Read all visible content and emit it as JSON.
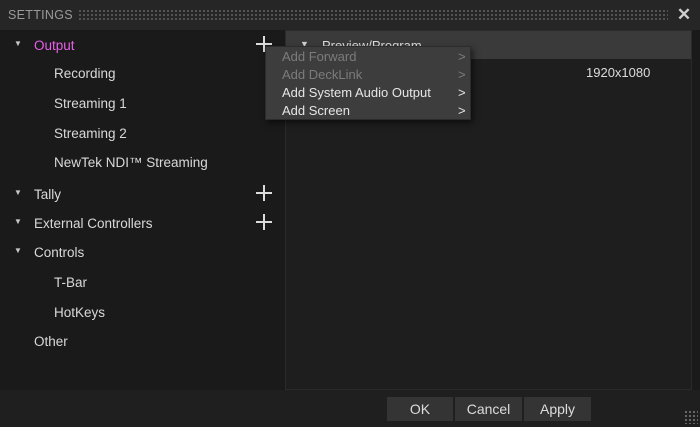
{
  "window": {
    "title": "SETTINGS",
    "close_symbol": "✕"
  },
  "colors": {
    "selected_text": "#e85fe8",
    "menu_bg": "#3d3d3d",
    "header_bg": "#3a3a3a"
  },
  "tree": {
    "output": {
      "label": "Output",
      "selected": true
    },
    "recording": {
      "label": "Recording"
    },
    "streaming1": {
      "label": "Streaming 1"
    },
    "streaming2": {
      "label": "Streaming 2"
    },
    "ndi": {
      "label": "NewTek NDI™ Streaming"
    },
    "tally": {
      "label": "Tally"
    },
    "external_controllers": {
      "label": "External Controllers"
    },
    "controls": {
      "label": "Controls"
    },
    "tbar": {
      "label": "T-Bar"
    },
    "hotkeys": {
      "label": "HotKeys"
    },
    "other": {
      "label": "Other"
    }
  },
  "panel": {
    "header_label": "Preview/Program",
    "header_arrow": "▼",
    "resolution": "1920x1080"
  },
  "context_menu": {
    "items": [
      {
        "label": "Add Forward",
        "chevron": ">",
        "enabled": false
      },
      {
        "label": "Add DeckLink",
        "chevron": ">",
        "enabled": false
      },
      {
        "label": "Add System Audio Output",
        "chevron": ">",
        "enabled": true
      },
      {
        "label": "Add Screen",
        "chevron": ">",
        "enabled": true
      }
    ]
  },
  "buttons": {
    "ok": "OK",
    "cancel": "Cancel",
    "apply": "Apply"
  }
}
